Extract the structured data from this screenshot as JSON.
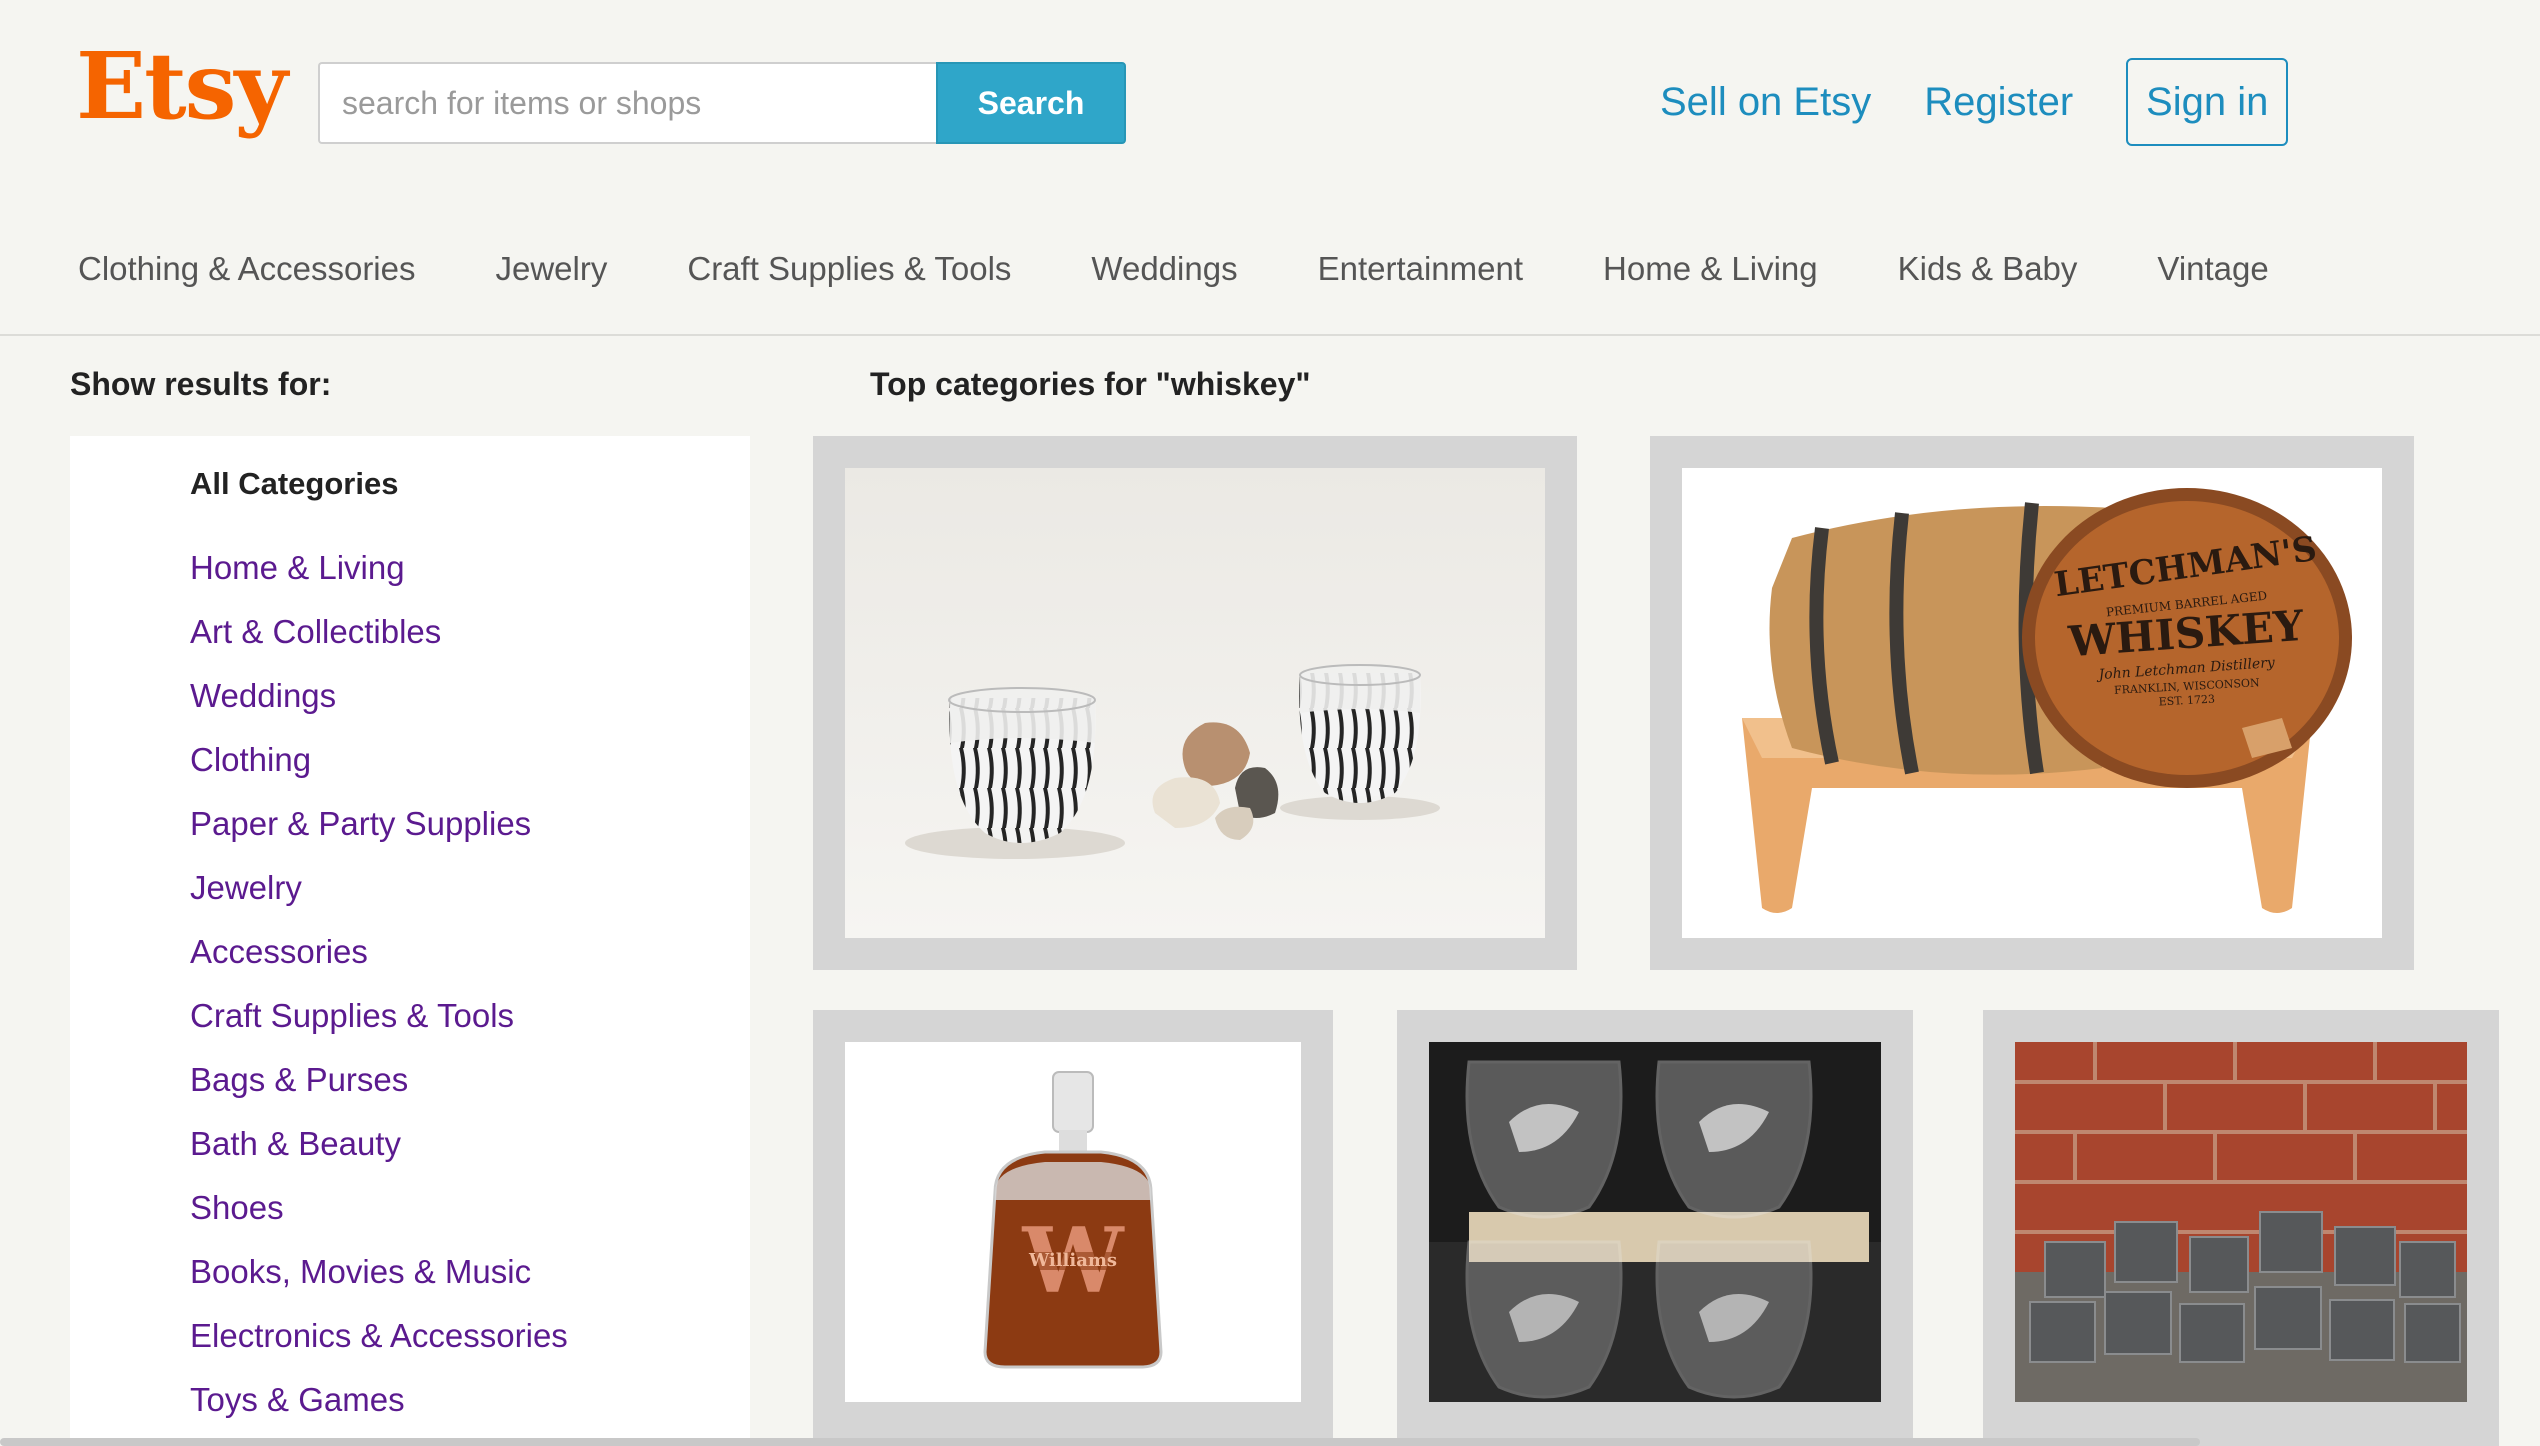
{
  "header": {
    "logo": "Etsy",
    "search_placeholder": "search for items or shops",
    "search_button": "Search",
    "links": [
      "Sell on Etsy",
      "Register"
    ],
    "signin": "Sign in"
  },
  "nav": [
    "Clothing & Accessories",
    "Jewelry",
    "Craft Supplies & Tools",
    "Weddings",
    "Entertainment",
    "Home & Living",
    "Kids & Baby",
    "Vintage"
  ],
  "sidebar": {
    "heading": "Show results for:",
    "all_categories": "All Categories",
    "categories": [
      "Home & Living",
      "Art & Collectibles",
      "Weddings",
      "Clothing",
      "Paper & Party Supplies",
      "Jewelry",
      "Accessories",
      "Craft Supplies & Tools",
      "Bags & Purses",
      "Bath & Beauty",
      "Shoes",
      "Books, Movies & Music",
      "Electronics & Accessories",
      "Toys & Games"
    ]
  },
  "main": {
    "title": "Top categories for \"whiskey\"",
    "barrel_text": [
      "LETCHMAN'S",
      "PREMIUM BARREL AGED",
      "WHISKEY",
      "John Letchman Distillery",
      "FRANKLIN, WISCONSON",
      "EST. 1723"
    ],
    "decanter_text": "Williams",
    "decanter_initial": "W"
  },
  "colors": {
    "brand": "#f56400",
    "link": "#1d8dbe",
    "category": "#5b1a8f",
    "search_button": "#2fa6c9"
  }
}
